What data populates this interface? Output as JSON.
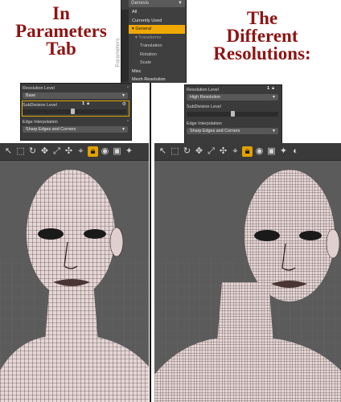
{
  "headlines": {
    "left": [
      "In",
      "Parameters",
      "Tab"
    ],
    "right": [
      "The",
      "Different",
      "Resolutions:"
    ]
  },
  "parameters_panel": {
    "tab_label": "Parameters",
    "select_value": "Genesis",
    "menu": [
      {
        "label": "All",
        "state": "normal"
      },
      {
        "label": "Currently Used",
        "state": "normal"
      },
      {
        "label": "General",
        "state": "active"
      },
      {
        "label": "Transforms",
        "state": "dim"
      },
      {
        "label": "Translation",
        "state": "sub"
      },
      {
        "label": "Rotation",
        "state": "sub"
      },
      {
        "label": "Scale",
        "state": "sub"
      },
      {
        "label": "Misc",
        "state": "normal"
      },
      {
        "label": "Mesh Resolution",
        "state": "normal"
      }
    ]
  },
  "settings_left": {
    "resolution_label": "Resolution Level",
    "resolution_value": "Base",
    "subdivision_label": "SubDivision Level",
    "subdivision_value": "1",
    "edge_label": "Edge Interpolation",
    "edge_value": "Sharp Edges and Corners"
  },
  "settings_right": {
    "resolution_label": "Resolution Level",
    "resolution_value": "High Resolution",
    "subdivision_label": "SubDivision Level",
    "subdivision_value": "1",
    "edge_label": "Edge Interpolation",
    "edge_value": "Sharp Edges and Corners"
  },
  "toolbar_icons": [
    "pointer-icon",
    "node-select-icon",
    "rotate-icon",
    "translate-icon",
    "scale-icon",
    "universal-icon",
    "joint-icon",
    "lock-icon",
    "camera-icon",
    "render-icon",
    "spot-icon",
    "more-icon"
  ],
  "colors": {
    "headline": "#8e1414",
    "accent": "#f0a800",
    "panel_bg": "#3b3b3b",
    "viewport_bg": "#5b5b5b",
    "mesh_skin": "#e6d6d6",
    "mesh_line": "#2a1e1e"
  }
}
